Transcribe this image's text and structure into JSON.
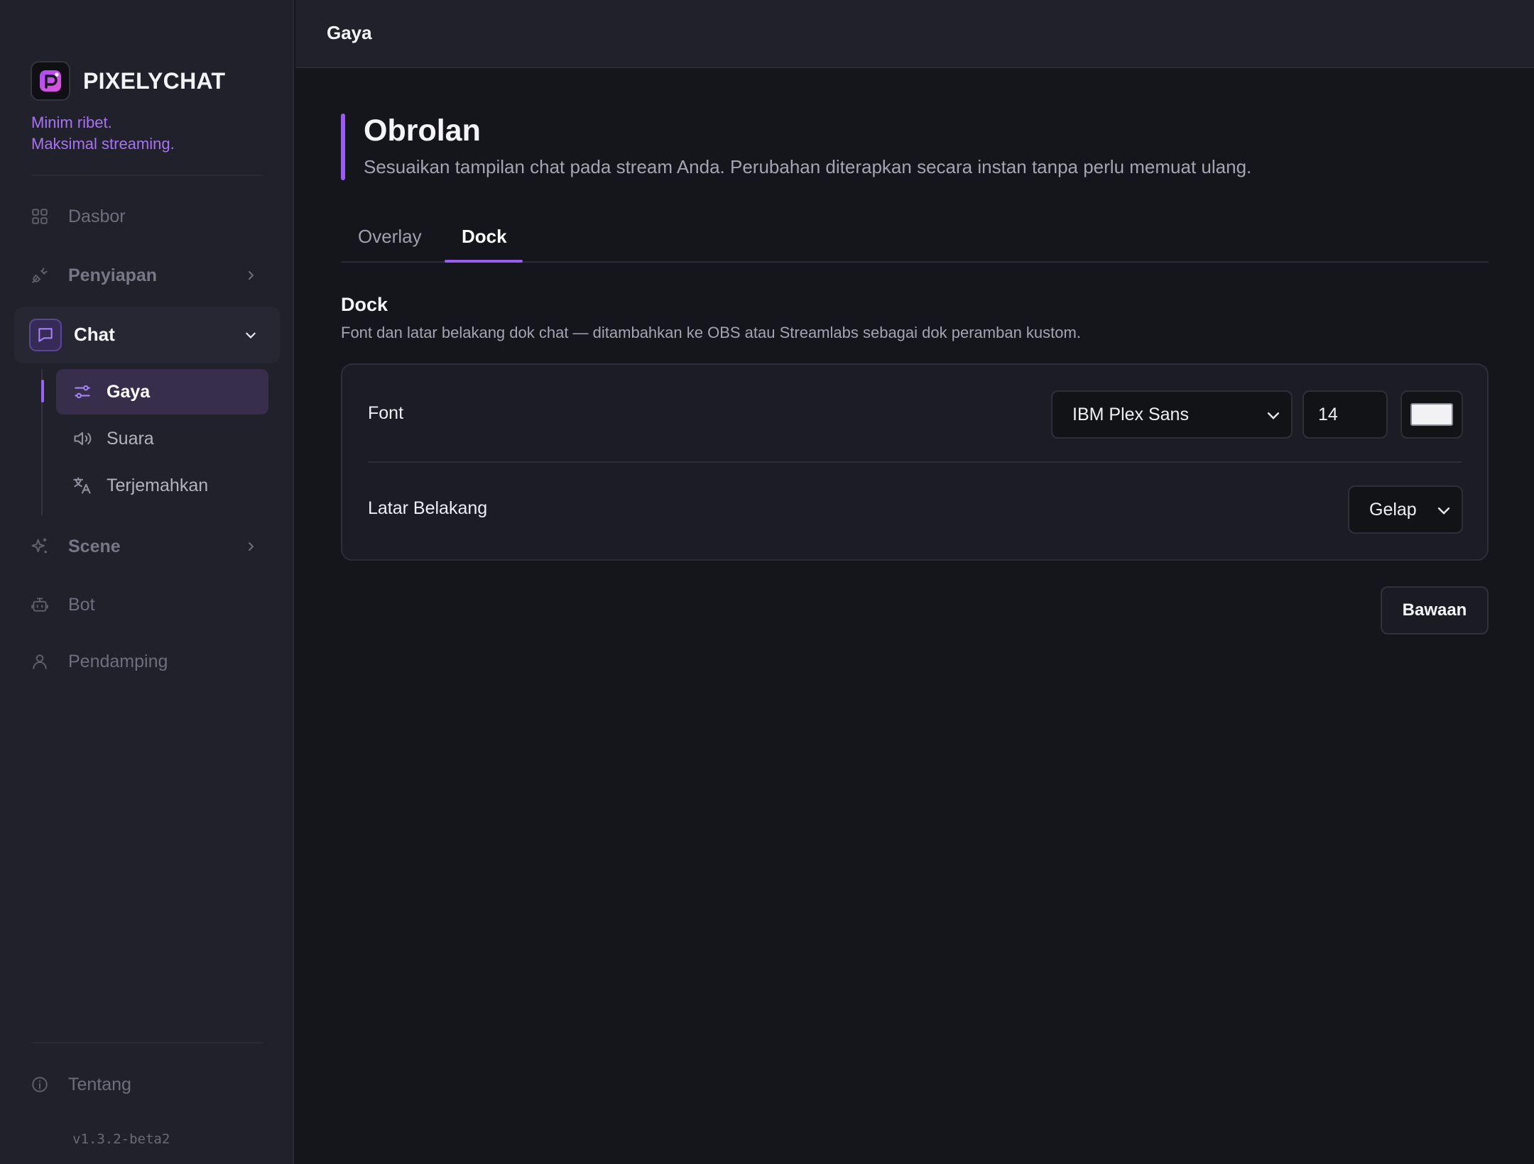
{
  "brand": {
    "name": "PIXELYCHAT",
    "tagline_line1": "Minim ribet.",
    "tagline_line2": "Maksimal streaming."
  },
  "colors": {
    "accent": "#9b5cf6",
    "sidebar_bg": "#21212b",
    "main_bg": "#15161b",
    "text_color_swatch": "#f2f2f5"
  },
  "sidebar": {
    "items": [
      {
        "label": "Dasbor",
        "icon": "grid-icon"
      },
      {
        "label": "Penyiapan",
        "icon": "plug-icon",
        "expandable": true
      },
      {
        "label": "Chat",
        "icon": "chat-bubble-icon",
        "expanded": true,
        "active": true
      },
      {
        "label": "Scene",
        "icon": "sparkles-icon",
        "expandable": true
      },
      {
        "label": "Bot",
        "icon": "robot-icon"
      },
      {
        "label": "Pendamping",
        "icon": "user-icon"
      }
    ],
    "chat_subitems": [
      {
        "label": "Gaya",
        "icon": "sliders-icon",
        "active": true
      },
      {
        "label": "Suara",
        "icon": "speaker-icon"
      },
      {
        "label": "Terjemahkan",
        "icon": "translate-icon"
      }
    ],
    "footer": {
      "about_label": "Tentang",
      "about_icon": "info-icon",
      "version": "v1.3.2-beta2"
    }
  },
  "header": {
    "title": "Gaya"
  },
  "main": {
    "title": "Obrolan",
    "description": "Sesuaikan tampilan chat pada stream Anda. Perubahan diterapkan secara instan tanpa perlu memuat ulang.",
    "tabs": [
      {
        "label": "Overlay",
        "active": false
      },
      {
        "label": "Dock",
        "active": true
      }
    ],
    "section": {
      "title": "Dock",
      "description": "Font dan latar belakang dok chat — ditambahkan ke OBS atau Streamlabs sebagai dok peramban kustom."
    },
    "settings": {
      "font": {
        "label": "Font",
        "family": "IBM Plex Sans",
        "size": "14",
        "color": "#f2f2f5"
      },
      "background": {
        "label": "Latar Belakang",
        "value": "Gelap"
      }
    },
    "default_button": "Bawaan"
  }
}
